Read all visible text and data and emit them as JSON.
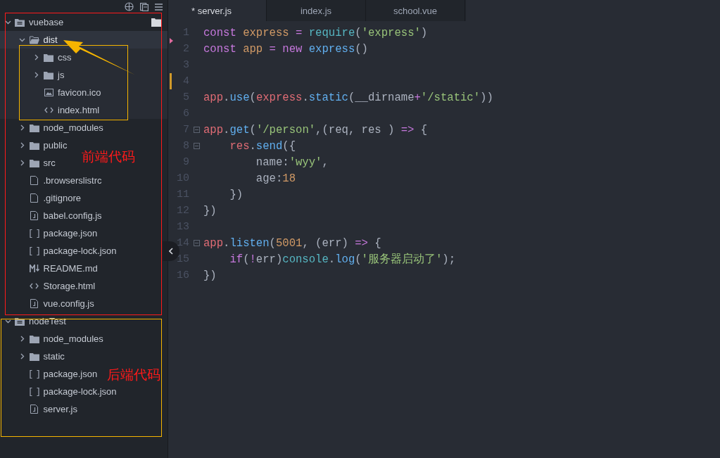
{
  "sidebar": {
    "tree": [
      {
        "label": "vuebase",
        "kind": "project",
        "expanded": true,
        "selected": false,
        "children": [
          {
            "label": "dist",
            "kind": "folder",
            "expanded": true,
            "selected": true,
            "children": [
              {
                "label": "css",
                "kind": "folder",
                "expanded": false,
                "selected": false
              },
              {
                "label": "js",
                "kind": "folder",
                "expanded": false,
                "selected": false
              },
              {
                "label": "favicon.ico",
                "kind": "image",
                "selected": false
              },
              {
                "label": "index.html",
                "kind": "code",
                "selected": false
              }
            ]
          },
          {
            "label": "node_modules",
            "kind": "folder",
            "expanded": false,
            "selected": false
          },
          {
            "label": "public",
            "kind": "folder",
            "expanded": false,
            "selected": false
          },
          {
            "label": "src",
            "kind": "folder",
            "expanded": false,
            "selected": false
          },
          {
            "label": ".browserslistrc",
            "kind": "file",
            "selected": false
          },
          {
            "label": ".gitignore",
            "kind": "file",
            "selected": false
          },
          {
            "label": "babel.config.js",
            "kind": "script",
            "selected": false
          },
          {
            "label": "package.json",
            "kind": "json",
            "selected": false
          },
          {
            "label": "package-lock.json",
            "kind": "json",
            "selected": false
          },
          {
            "label": "README.md",
            "kind": "markdown",
            "selected": false
          },
          {
            "label": "Storage.html",
            "kind": "code",
            "selected": false
          },
          {
            "label": "vue.config.js",
            "kind": "script",
            "selected": false
          }
        ]
      },
      {
        "label": "nodeTest",
        "kind": "project",
        "expanded": true,
        "selected": false,
        "children": [
          {
            "label": "node_modules",
            "kind": "folder",
            "expanded": false,
            "selected": false
          },
          {
            "label": "static",
            "kind": "folder",
            "expanded": false,
            "selected": false
          },
          {
            "label": "package.json",
            "kind": "json",
            "selected": false
          },
          {
            "label": "package-lock.json",
            "kind": "json",
            "selected": false
          },
          {
            "label": "server.js",
            "kind": "script",
            "selected": false
          }
        ]
      }
    ]
  },
  "annotations": [
    {
      "text": "前端代码",
      "color": "#ff1a1a"
    },
    {
      "text": "后端代码",
      "color": "#ff1a1a"
    }
  ],
  "tabs": [
    {
      "label": "* server.js",
      "selected": true
    },
    {
      "label": "index.js",
      "selected": false
    },
    {
      "label": "school.vue",
      "selected": false
    }
  ],
  "editor": {
    "lines": [
      {
        "number": "1",
        "tokens": [
          {
            "kind": "keyword",
            "text": "const "
          },
          {
            "kind": "decl",
            "text": "express "
          },
          {
            "kind": "operator",
            "text": "= "
          },
          {
            "kind": "builtin",
            "text": "require"
          },
          {
            "kind": "plain",
            "text": "("
          },
          {
            "kind": "string",
            "text": "'express'"
          },
          {
            "kind": "plain",
            "text": ")"
          }
        ]
      },
      {
        "number": "2",
        "deleted": true,
        "tokens": [
          {
            "kind": "keyword",
            "text": "const "
          },
          {
            "kind": "decl",
            "text": "app "
          },
          {
            "kind": "operator",
            "text": "= "
          },
          {
            "kind": "keyword",
            "text": "new "
          },
          {
            "kind": "method",
            "text": "express"
          },
          {
            "kind": "plain",
            "text": "()"
          }
        ]
      },
      {
        "number": "3"
      },
      {
        "number": "4",
        "modified": true
      },
      {
        "number": "5",
        "tokens": [
          {
            "kind": "variable",
            "text": "app"
          },
          {
            "kind": "plain",
            "text": "."
          },
          {
            "kind": "method",
            "text": "use"
          },
          {
            "kind": "plain",
            "text": "("
          },
          {
            "kind": "variable",
            "text": "express"
          },
          {
            "kind": "plain",
            "text": "."
          },
          {
            "kind": "method",
            "text": "static"
          },
          {
            "kind": "plain",
            "text": "(__dirname"
          },
          {
            "kind": "operator",
            "text": "+"
          },
          {
            "kind": "string",
            "text": "'/static'"
          },
          {
            "kind": "plain",
            "text": "))"
          }
        ]
      },
      {
        "number": "6"
      },
      {
        "number": "7",
        "foldable": true,
        "tokens": [
          {
            "kind": "variable",
            "text": "app"
          },
          {
            "kind": "plain",
            "text": "."
          },
          {
            "kind": "method",
            "text": "get"
          },
          {
            "kind": "plain",
            "text": "("
          },
          {
            "kind": "string",
            "text": "'/person'"
          },
          {
            "kind": "plain",
            "text": ",(req, res ) "
          },
          {
            "kind": "operator",
            "text": "=>"
          },
          {
            "kind": "plain",
            "text": " {"
          }
        ]
      },
      {
        "number": "8",
        "foldable": true,
        "tokens": [
          {
            "kind": "variable",
            "text": "    res"
          },
          {
            "kind": "plain",
            "text": "."
          },
          {
            "kind": "method",
            "text": "send"
          },
          {
            "kind": "plain",
            "text": "({"
          }
        ]
      },
      {
        "number": "9",
        "tokens": [
          {
            "kind": "plain",
            "text": "        name:"
          },
          {
            "kind": "string",
            "text": "'wyy'"
          },
          {
            "kind": "plain",
            "text": ","
          }
        ]
      },
      {
        "number": "10",
        "tokens": [
          {
            "kind": "plain",
            "text": "        age:"
          },
          {
            "kind": "number",
            "text": "18"
          }
        ]
      },
      {
        "number": "11",
        "tokens": [
          {
            "kind": "plain",
            "text": "    })"
          }
        ]
      },
      {
        "number": "12",
        "tokens": [
          {
            "kind": "plain",
            "text": "})"
          }
        ]
      },
      {
        "number": "13"
      },
      {
        "number": "14",
        "foldable": true,
        "tokens": [
          {
            "kind": "variable",
            "text": "app"
          },
          {
            "kind": "plain",
            "text": "."
          },
          {
            "kind": "method",
            "text": "listen"
          },
          {
            "kind": "plain",
            "text": "("
          },
          {
            "kind": "number",
            "text": "5001"
          },
          {
            "kind": "plain",
            "text": ", (err) "
          },
          {
            "kind": "operator",
            "text": "=>"
          },
          {
            "kind": "plain",
            "text": " {"
          }
        ]
      },
      {
        "number": "15",
        "tokens": [
          {
            "kind": "keyword",
            "text": "    if"
          },
          {
            "kind": "plain",
            "text": "("
          },
          {
            "kind": "operator",
            "text": "!"
          },
          {
            "kind": "plain",
            "text": "err)"
          },
          {
            "kind": "builtin",
            "text": "console"
          },
          {
            "kind": "plain",
            "text": "."
          },
          {
            "kind": "method",
            "text": "log"
          },
          {
            "kind": "plain",
            "text": "("
          },
          {
            "kind": "string",
            "text": "'服务器启动了'"
          },
          {
            "kind": "plain",
            "text": ");"
          }
        ]
      },
      {
        "number": "16",
        "tokens": [
          {
            "kind": "plain",
            "text": "})"
          }
        ]
      }
    ]
  }
}
